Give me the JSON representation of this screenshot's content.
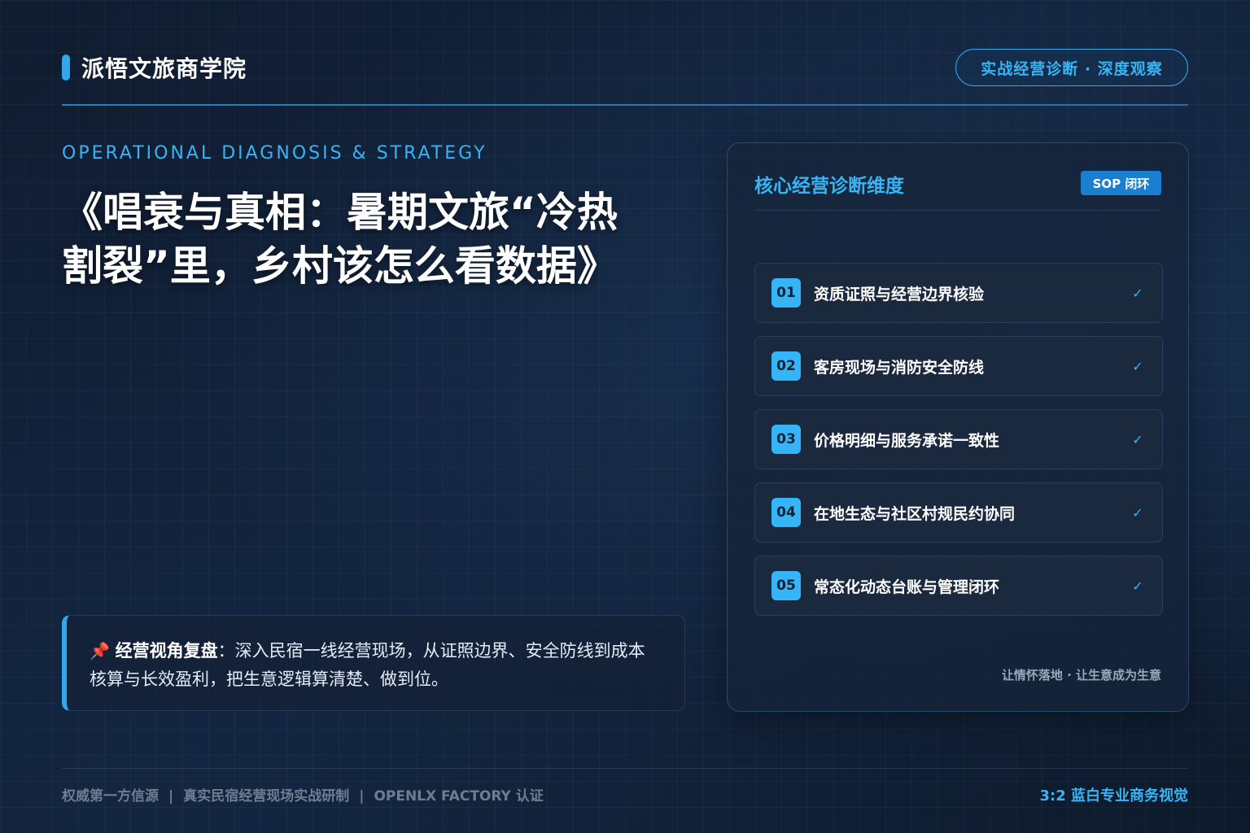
{
  "brand": {
    "name": "派悟文旅商学院"
  },
  "header": {
    "pill": "实战经营诊断 · 深度观察"
  },
  "eyebrow": "OPERATIONAL DIAGNOSIS & STRATEGY",
  "title": {
    "line1": "《唱衰与真相：暑期文旅“冷热",
    "line2": "割裂”里，乡村该怎么看数据》"
  },
  "note": {
    "icon": "pushpin-icon",
    "label": "经营视角复盘",
    "text": "：深入民宿一线经营现场，从证照边界、安全防线到成本核算与长效盈利，把生意逻辑算清楚、做到位。"
  },
  "panel": {
    "title": "核心经营诊断维度",
    "badge": "SOP 闭环",
    "items": [
      {
        "num": "01",
        "label": "资质证照与经营边界核验",
        "check": "✓"
      },
      {
        "num": "02",
        "label": "客房现场与消防安全防线",
        "check": "✓"
      },
      {
        "num": "03",
        "label": "价格明细与服务承诺一致性",
        "check": "✓"
      },
      {
        "num": "04",
        "label": "在地生态与社区村规民约协同",
        "check": "✓"
      },
      {
        "num": "05",
        "label": "常态化动态台账与管理闭环",
        "check": "✓"
      }
    ],
    "footer": "让情怀落地 · 让生意成为生意"
  },
  "footer": {
    "left": [
      "权威第一方信源",
      "真实民宿经营现场实战研制",
      "OPENLX FACTORY 认证"
    ],
    "separator": "|",
    "right": "3:2 蓝白专业商务视觉"
  },
  "colors": {
    "accent": "#2fa8ee",
    "background": "#0f1b2e"
  }
}
